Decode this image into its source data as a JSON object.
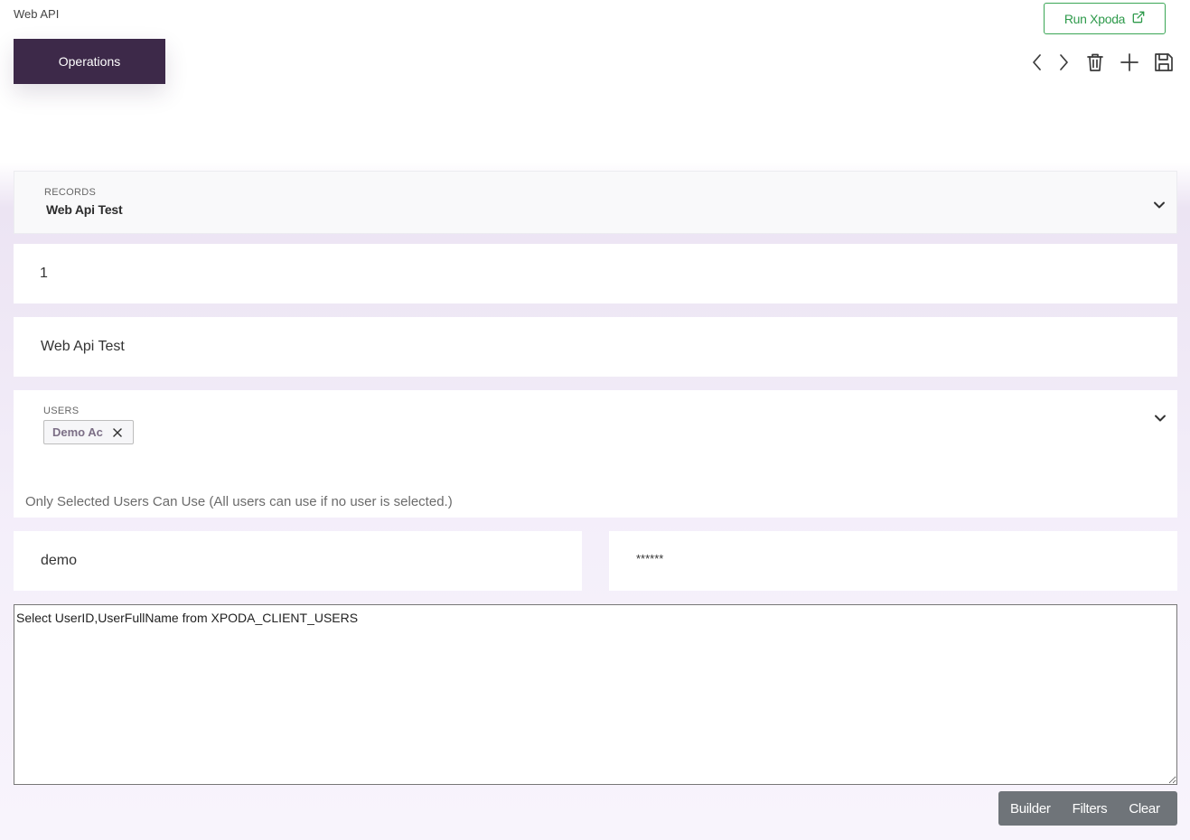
{
  "breadcrumb": "Web API",
  "operations_label": "Operations",
  "run_button_label": "Run Xpoda",
  "toolbar": {
    "icons": [
      "chevron-left-icon",
      "chevron-right-icon",
      "trash-icon",
      "plus-icon",
      "save-icon"
    ]
  },
  "records": {
    "label": "RECORDS",
    "value": "Web Api Test"
  },
  "id_field": {
    "value": "1"
  },
  "name_field": {
    "value": "Web Api Test"
  },
  "users": {
    "label": "USERS",
    "chips": [
      "Demo Ac"
    ],
    "hint": "Only Selected Users Can Use (All users can use if no user is selected.)"
  },
  "username_field": {
    "value": "demo"
  },
  "password_field": {
    "value": "******"
  },
  "query": {
    "value": "Select UserID,UserFullName from XPODA_CLIENT_USERS"
  },
  "actions": {
    "builder": "Builder",
    "filters": "Filters",
    "clear": "Clear"
  },
  "colors": {
    "primary_dark": "#3d2949",
    "run_green": "#2e9a4b",
    "action_gray": "#6f7479"
  }
}
